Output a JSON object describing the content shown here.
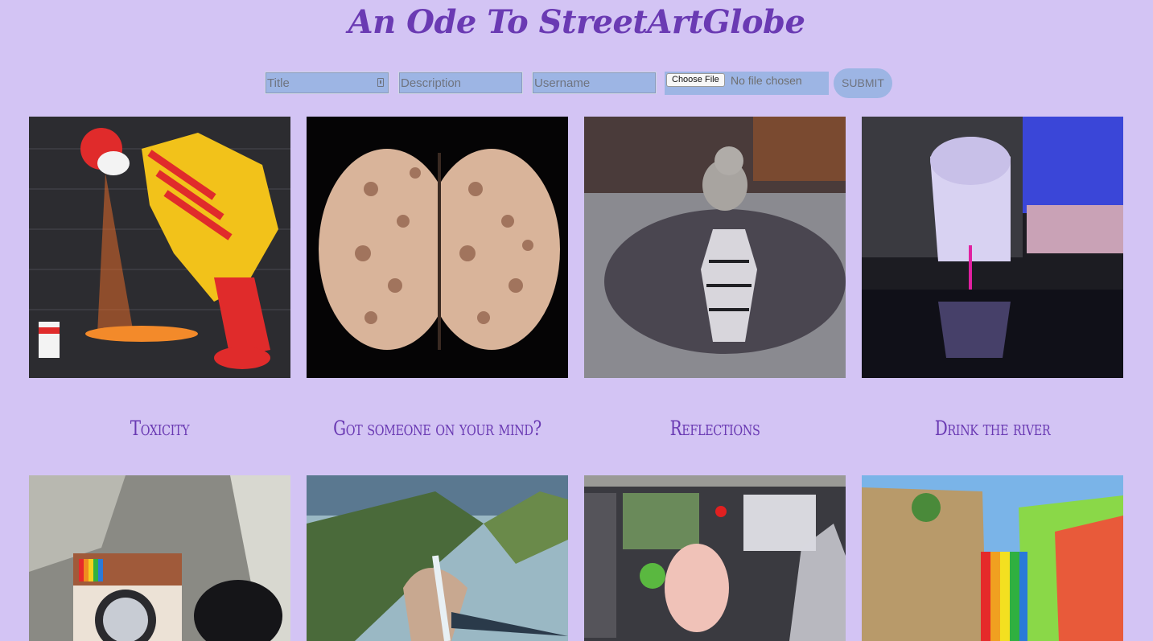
{
  "header": {
    "title": "An Ode To StreetArtGlobe"
  },
  "form": {
    "title_placeholder": "Title",
    "description_placeholder": "Description",
    "username_placeholder": "Username",
    "choose_file_label": "Choose File",
    "no_file_text": "No file chosen",
    "submit_label": "SUBMIT"
  },
  "gallery": {
    "row1": [
      {
        "caption": "Toxicity",
        "image": "clown-vomit-mural"
      },
      {
        "caption": "Got someone on your mind?",
        "image": "brain-of-bodies"
      },
      {
        "caption": "Reflections",
        "image": "kitten-tiger-reflection"
      },
      {
        "caption": "Drink the river",
        "image": "face-on-river-wall"
      }
    ],
    "row2": [
      {
        "image": "instagram-washing-machine"
      },
      {
        "image": "nature-face-waterfall"
      },
      {
        "image": "pig-man-mural"
      },
      {
        "image": "rainbow-stairs-favela"
      }
    ]
  },
  "colors": {
    "background": "#d3c4f4",
    "accent": "#6a3ab3",
    "field": "#9db5e4"
  }
}
